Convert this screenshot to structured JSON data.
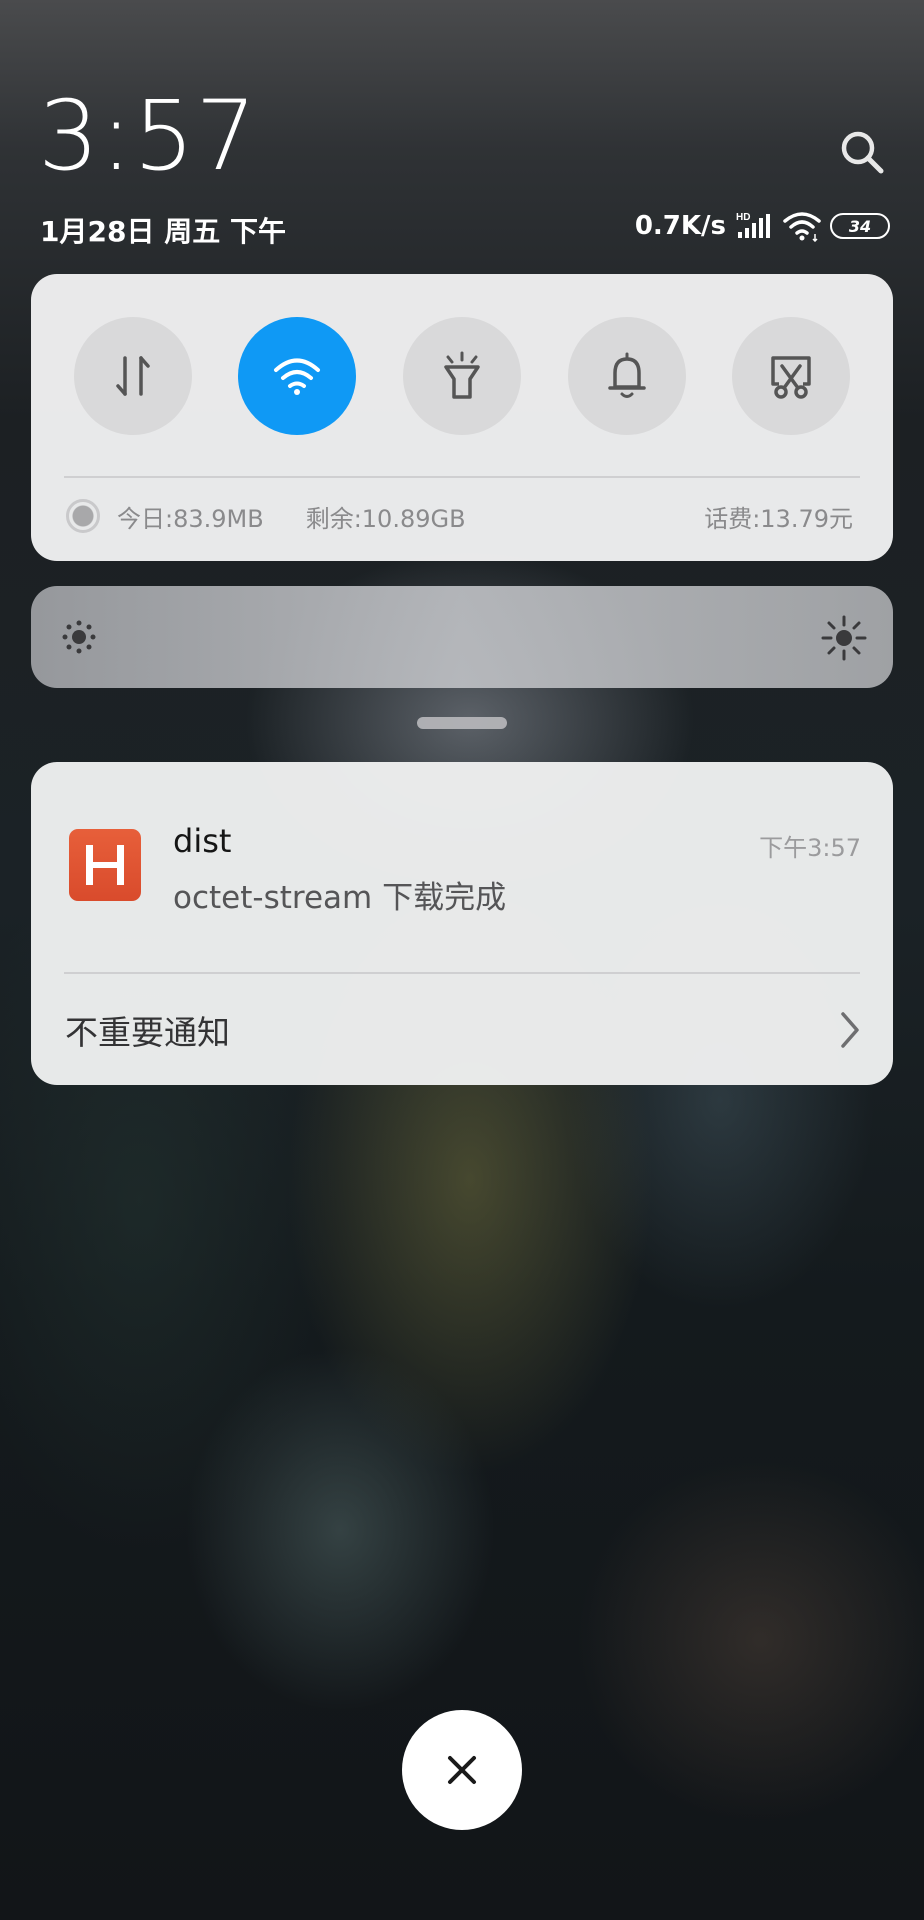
{
  "header": {
    "time": "3:57",
    "date": "1月28日 周五 下午",
    "net_speed": "0.7K/s",
    "signal_badge": "HD",
    "battery_level": "34"
  },
  "quick_settings": {
    "toggles": [
      {
        "name": "mobile-data",
        "icon": "data-transfer-icon",
        "active": false
      },
      {
        "name": "wifi",
        "icon": "wifi-icon",
        "active": true
      },
      {
        "name": "flashlight",
        "icon": "flashlight-icon",
        "active": false
      },
      {
        "name": "sound",
        "icon": "bell-icon",
        "active": false
      },
      {
        "name": "screenshot",
        "icon": "screenshot-scissors-icon",
        "active": false
      }
    ],
    "data_today": "今日:83.9MB",
    "data_remaining": "剩余:10.89GB",
    "balance": "话费:13.79元",
    "active_color": "#0f99f5"
  },
  "brightness": {
    "low_icon": "brightness-low-icon",
    "high_icon": "brightness-high-icon"
  },
  "notification": {
    "app_icon_letter": "H",
    "app_icon_color": "#e0553a",
    "app_name": "dist",
    "time": "下午3:57",
    "body": "octet-stream 下载完成",
    "unimportant_label": "不重要通知"
  },
  "close_icon": "close-icon"
}
